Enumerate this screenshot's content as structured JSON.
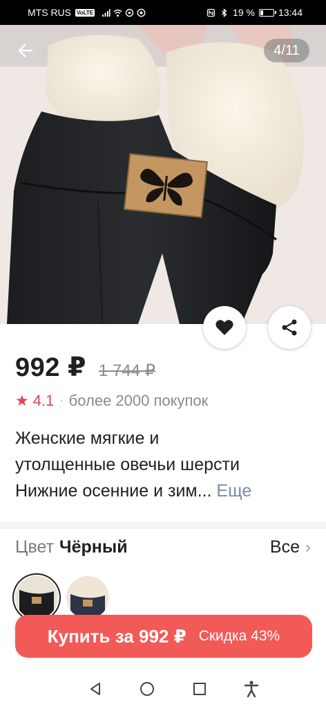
{
  "status": {
    "carrier": "MTS RUS",
    "volte": "VoLTE",
    "battery_percent": "19 %",
    "battery_level": 0.19,
    "time": "13:44"
  },
  "gallery": {
    "counter": "4/11"
  },
  "product": {
    "price": "992 ₽",
    "old_price": "1 744 ₽",
    "rating": "4.1",
    "rating_separator": "·",
    "purchases": "более 2000 покупок",
    "title_lines": [
      "Женские мягкие и",
      "утолщенные овечьи шерсти",
      "Нижние осенние и зим..."
    ],
    "more_label": "Еще"
  },
  "color": {
    "label": "Цвет",
    "value": "Чёрный",
    "all_label": "Все"
  },
  "buy": {
    "label": "Купить за 992 ₽",
    "discount": "Скидка 43%"
  },
  "icons": {
    "back": "arrow-left-icon",
    "favorite": "heart-icon",
    "share": "share-icon",
    "star": "star-icon",
    "nav_back": "triangle-back-icon",
    "nav_home": "circle-home-icon",
    "nav_recents": "square-recents-icon",
    "accessibility": "accessibility-icon"
  },
  "colors": {
    "accent": "#f25a58",
    "rating": "#e8404f",
    "link": "#7a89a8"
  }
}
